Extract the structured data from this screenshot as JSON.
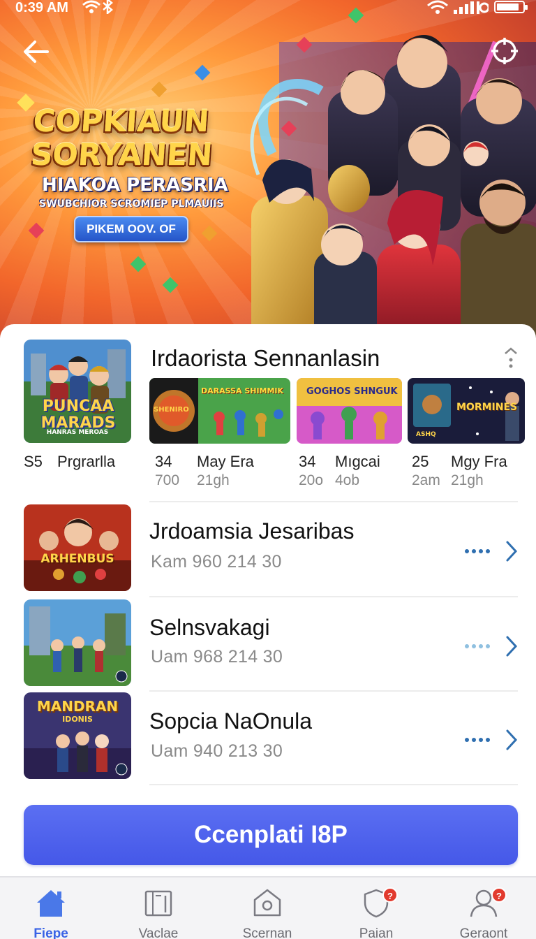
{
  "status_bar": {
    "time": "0:39 AM",
    "network": "",
    "battery_level": 0.85
  },
  "hero": {
    "title_line1": "COPKIAUN",
    "title_line2": "SORYANEN",
    "subtitle": "HIAKOA PERASRIA",
    "tagline": "SWUBCHIOR SCROMIEP PLMAUIIS",
    "cta_label": "PIKEM OOV. OF"
  },
  "featured": {
    "thumb_title": "PUNCAA MARADS",
    "thumb_caption": "HANRAS MEROAS",
    "title": "Irdaorista Sennanlasin",
    "stat_main": {
      "a": "S5",
      "b": "Prgrarlla"
    },
    "tiles": [
      {
        "label": "DARASSA SHIMMIK",
        "badge": "SHENIRO",
        "stat_a": "34",
        "stat_b": "May Era",
        "sub_a": "700",
        "sub_b": "21gh"
      },
      {
        "label": "GOGHOS SHNGUK",
        "stat_a": "34",
        "stat_b": "Mıgcai",
        "sub_a": "20o",
        "sub_b": "4ob"
      },
      {
        "label": "MORMINES",
        "badge": "ASHQ",
        "stat_a": "25",
        "stat_b": "Mgy Fra",
        "sub_a": "2am",
        "sub_b": "21gh"
      }
    ]
  },
  "list": [
    {
      "title": "Jrdoamsia Jesaribas",
      "meta": "Kam 960 214  30",
      "thumb_text": "ARHENBUS"
    },
    {
      "title": "Selnsvakagi",
      "meta": "Uam 968 214  30",
      "thumb_text": ""
    },
    {
      "title": "Sopcia NaOnula",
      "meta": "Uam 940 213  30",
      "thumb_text": "MANDRAN",
      "thumb_sub": "IDONIS"
    }
  ],
  "primary_button": "Ccenplati I8P",
  "nav": [
    {
      "label": "Fiepe",
      "icon": "home-icon",
      "active": true
    },
    {
      "label": "Vaclae",
      "icon": "library-icon",
      "active": false
    },
    {
      "label": "Scernan",
      "icon": "store-icon",
      "active": false
    },
    {
      "label": "Paian",
      "icon": "shield-icon",
      "badge": "?",
      "active": false
    },
    {
      "label": "Geraont",
      "icon": "profile-icon",
      "badge": "?",
      "active": false
    }
  ],
  "colors": {
    "accent": "#4558e8",
    "nav_active": "#3a63e6",
    "badge": "#e23a2e",
    "dots_active": "#2f6fb0",
    "dots_inactive": "#8fc0e0"
  }
}
